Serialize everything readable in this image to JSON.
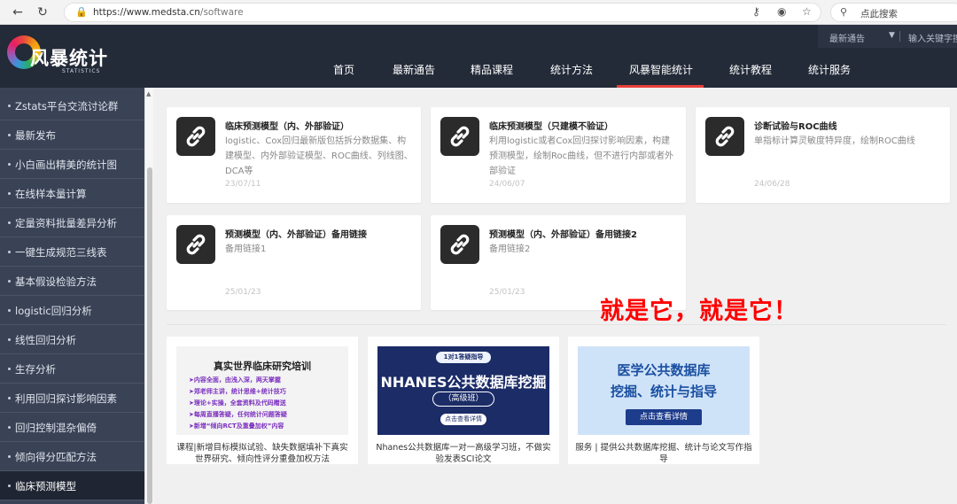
{
  "browser": {
    "url_host": "https://www.medsta.cn",
    "url_path": "/software",
    "search_placeholder": "点此搜索"
  },
  "site": {
    "logo_text": "风暴统计",
    "logo_sub": "STATISTICS",
    "topbar_notice": "最新通告",
    "topbar_dropdown": "▼",
    "topbar_search_placeholder": "输入关键字搜"
  },
  "nav": {
    "items": [
      "首页",
      "最新通告",
      "精品课程",
      "统计方法",
      "风暴智能统计",
      "统计教程",
      "统计服务"
    ],
    "active": "风暴智能统计"
  },
  "sidebar": {
    "items": [
      "Zstats平台交流讨论群",
      "最新发布",
      "小白画出精美的统计图",
      "在线样本量计算",
      "定量资料批量差异分析",
      "一键生成规范三线表",
      "基本假设检验方法",
      "logistic回归分析",
      "线性回归分析",
      "生存分析",
      "利用回归探讨影响因素",
      "回归控制混杂偏倚",
      "倾向得分匹配方法",
      "临床预测模型"
    ],
    "active": "临床预测模型"
  },
  "cards": [
    {
      "title": "临床预测模型（内、外部验证）",
      "desc": "logistic、Cox回归最新版包括拆分数据集、构建模型、内外部验证模型、ROC曲线、列线图、DCA等",
      "date": "23/07/11"
    },
    {
      "title": "临床预测模型（只建模不验证）",
      "desc": "利用logistic或者Cox回归探讨影响因素，构建预测模型，绘制Roc曲线，但不进行内部或者外部验证",
      "date": "24/06/07"
    },
    {
      "title": "诊断试验与ROC曲线",
      "desc": "单指标计算灵敏度特异度，绘制ROC曲线",
      "date": "24/06/28"
    },
    {
      "title": "预测模型（内、外部验证）备用链接",
      "desc": "备用链接1",
      "date": "25/01/23"
    },
    {
      "title": "预测模型（内、外部验证）备用链接2",
      "desc": "备用链接2",
      "date": "25/01/23"
    }
  ],
  "annotation": "就是它，就是它！",
  "banners": [
    {
      "title": "真实世界临床研究培训",
      "lines": [
        "➤内容全面，由浅入深，两天掌握",
        "➤郑老师主讲，统计思维+统计技巧",
        "➤理论+实操，全套资料及代码赠送",
        "➤每周直播答疑，任何统计问题答疑",
        "➤新增“倾向RCT及重叠加权”内容"
      ],
      "caption": "课程|新增目标模拟试验、缺失数据填补下真实世界研究、倾向性评分重叠加权方法"
    },
    {
      "pill": "1对1答疑指导",
      "title": "NHANES公共数据库挖掘",
      "level": "（高级班）",
      "cta": "点击查看详情",
      "caption": "Nhanes公共数据库一对一高级学习班，不做实验发表SCI论文"
    },
    {
      "line1": "医学公共数据库",
      "line2": "挖掘、统计与指导",
      "cta": "点击查看详情",
      "caption": "服务 | 提供公共数据库挖掘、统计与论文写作指导"
    }
  ],
  "colors": {
    "header_bg": "#232a38",
    "sidebar_bg": "#3a4356",
    "accent": "#e83f3a",
    "annotation": "#ff0000"
  }
}
